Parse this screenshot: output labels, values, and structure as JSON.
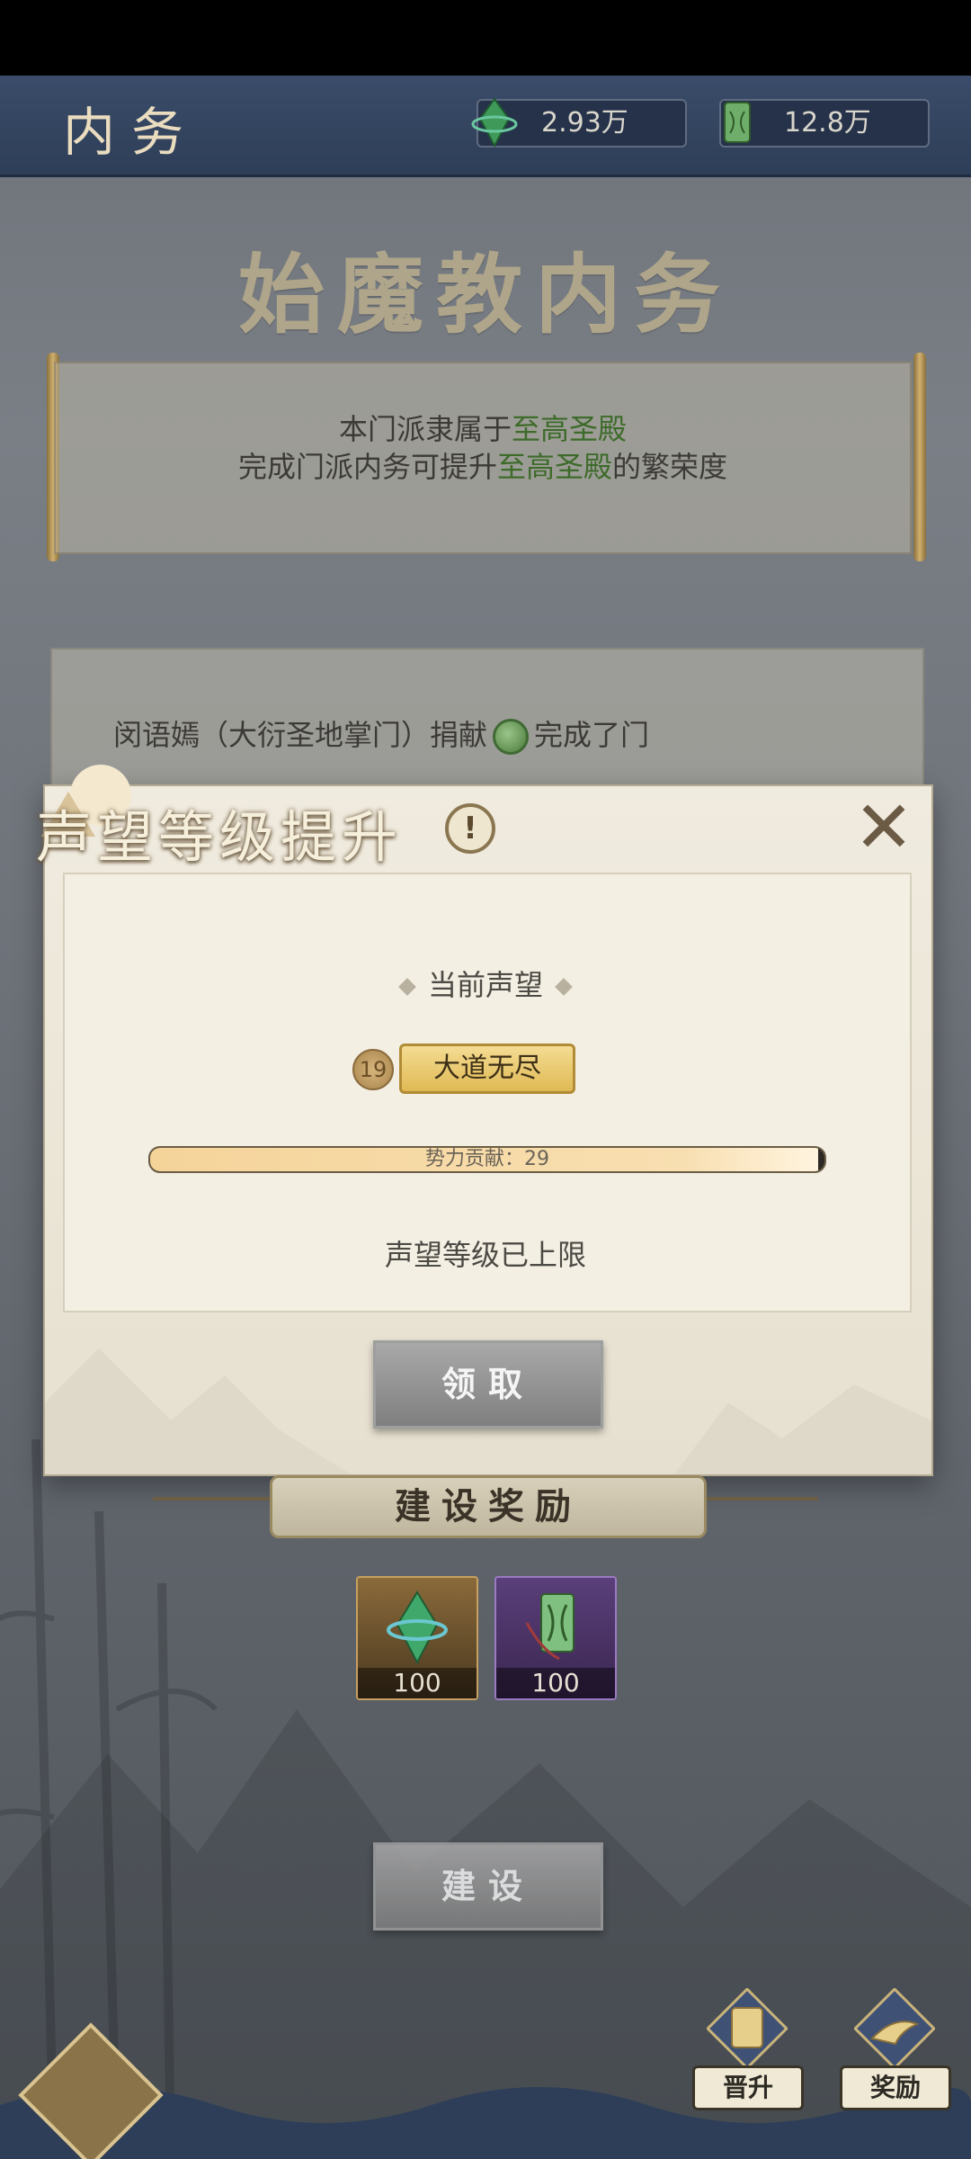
{
  "header": {
    "title": "内务",
    "resources": [
      {
        "icon": "jade-crystal-icon",
        "value": "2.93万"
      },
      {
        "icon": "jade-token-icon",
        "value": "12.8万"
      }
    ]
  },
  "page": {
    "big_title": "始魔教内务",
    "scroll_line1_prefix": "本门派隶属于",
    "scroll_line1_highlight": "至高圣殿",
    "scroll_line2_prefix": "完成门派内务可提升",
    "scroll_line2_highlight": "至高圣殿",
    "scroll_line2_suffix": "的繁荣度",
    "news_prefix": "闵语嫣（大衍圣地掌门）捐献",
    "news_suffix": "完成了门"
  },
  "modal": {
    "title": "声望等级提升",
    "info_label": "!",
    "close_label": "✕",
    "current_label": "当前声望",
    "level": "19",
    "rank_name": "大道无尽",
    "progress_text": "势力贡献：29",
    "progress_fraction": 0.99,
    "max_text": "声望等级已上限",
    "claim_button": "领取"
  },
  "rewards": {
    "section_title": "建设奖励",
    "items": [
      {
        "icon": "green-crystal-icon",
        "qty": "100"
      },
      {
        "icon": "jade-token-icon",
        "qty": "100"
      }
    ]
  },
  "actions": {
    "build_button": "建设",
    "promote_label": "晋升",
    "reward_label": "奖励"
  },
  "colors": {
    "highlight_green": "#3d6b2a",
    "topbar": "#2e3e58",
    "progress_fill": "#f5d49a"
  }
}
